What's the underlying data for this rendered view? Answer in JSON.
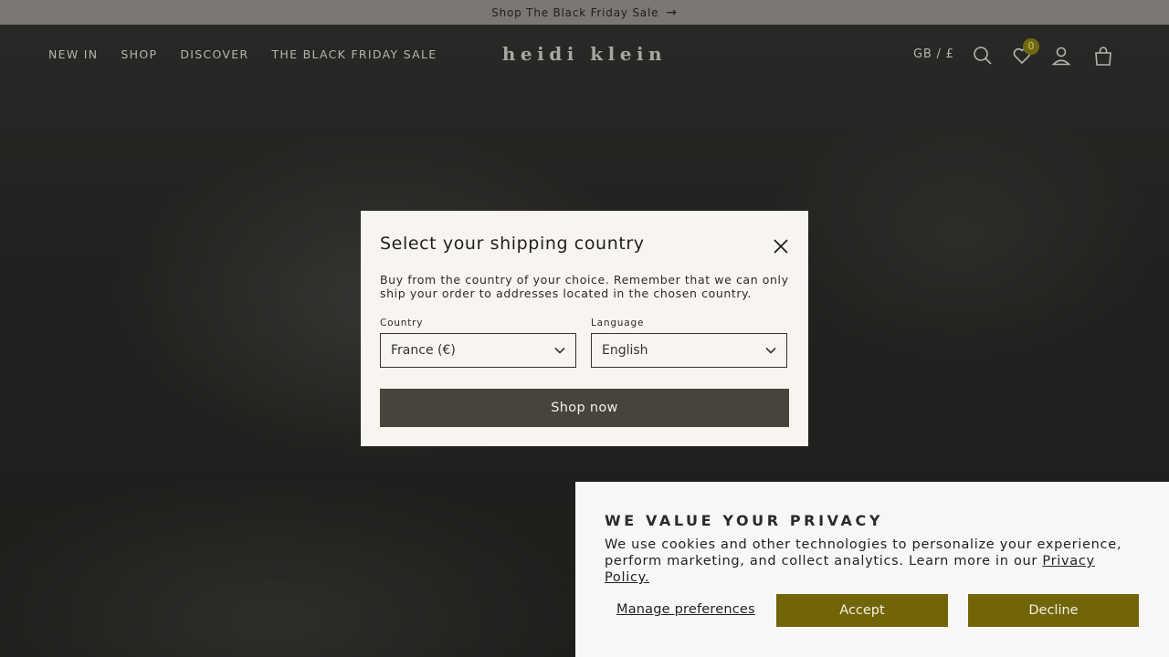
{
  "announcement": {
    "text": "Shop The Black Friday Sale",
    "arrow": "→"
  },
  "nav": {
    "items": [
      "NEW IN",
      "SHOP",
      "DISCOVER",
      "THE BLACK FRIDAY SALE"
    ]
  },
  "brand": {
    "logo_text": "heidi klein"
  },
  "header": {
    "locale": "GB / £",
    "wishlist_count": "0",
    "icons": [
      "search-icon",
      "heart-icon",
      "user-icon",
      "bag-icon"
    ]
  },
  "modal": {
    "title": "Select your shipping country",
    "description": "Buy from the country of your choice. Remember that we can only ship your order to addresses located in the chosen country.",
    "country_label": "Country",
    "country_value": "France (€)",
    "language_label": "Language",
    "language_value": "English",
    "submit_label": "Shop now"
  },
  "privacy": {
    "title": "WE VALUE YOUR PRIVACY",
    "text": "We use cookies and other technologies to personalize your experience, perform marketing, and collect analytics. Learn more in our",
    "link_label": "Privacy Policy.",
    "manage_label": "Manage preferences",
    "accept_label": "Accept",
    "decline_label": "Decline"
  },
  "colors": {
    "announcement_bg": "#7b7873",
    "modal_bg": "#f8f5f0",
    "primary_button": "#46443b",
    "accent_olive": "#726509"
  }
}
